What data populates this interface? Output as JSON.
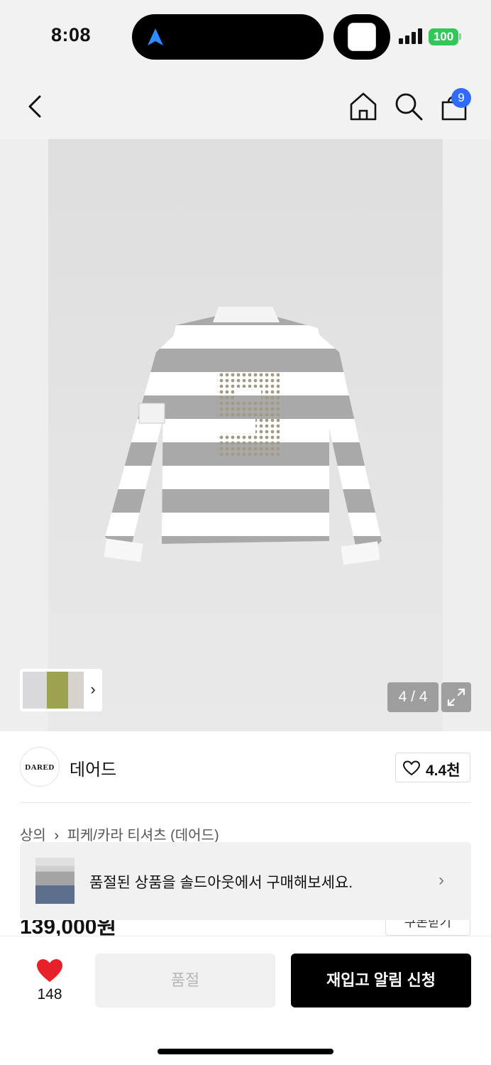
{
  "status": {
    "time": "8:08",
    "battery": "100"
  },
  "header": {
    "cart_count": "9"
  },
  "gallery": {
    "counter": "4 / 4"
  },
  "brand": {
    "logo_text": "DARED",
    "name": "데어드",
    "likes": "4.4천"
  },
  "breadcrumb": {
    "items": [
      "상의",
      "피케/카라 티셔츠 (데어드)"
    ]
  },
  "product": {
    "price": "139,000원",
    "coupon_label": "쿠폰받기"
  },
  "soldout_banner": {
    "text": "품절된 상품을 솔드아웃에서 구매해보세요."
  },
  "bottom": {
    "wish_count": "148",
    "soldout_label": "품절",
    "restock_label": "재입고 알림 신청"
  },
  "colors": {
    "accent_blue": "#2f6bff",
    "battery_green": "#32c759",
    "heart_red": "#e8202a",
    "stripe_grey": "#a8a8a8"
  }
}
